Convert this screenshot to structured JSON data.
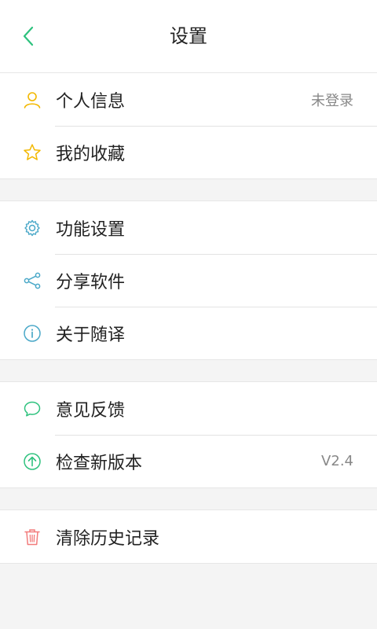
{
  "header": {
    "title": "设置",
    "back_icon": "chevron-left-icon"
  },
  "colors": {
    "accent_green": "#2ec27e",
    "yellow": "#f3b800",
    "blue": "#4aa8c8",
    "red": "#f27b7b"
  },
  "sections": [
    {
      "items": [
        {
          "label": "个人信息",
          "value": "未登录",
          "icon": "user-icon"
        },
        {
          "label": "我的收藏",
          "icon": "star-icon"
        }
      ]
    },
    {
      "items": [
        {
          "label": "功能设置",
          "icon": "gear-icon"
        },
        {
          "label": "分享软件",
          "icon": "share-icon"
        },
        {
          "label": "关于随译",
          "icon": "info-icon"
        }
      ]
    },
    {
      "items": [
        {
          "label": "意见反馈",
          "icon": "chat-bubble-icon"
        },
        {
          "label": "检查新版本",
          "value": "V2.4",
          "icon": "upload-arrow-icon"
        }
      ]
    },
    {
      "items": [
        {
          "label": "清除历史记录",
          "icon": "trash-icon"
        }
      ]
    }
  ]
}
